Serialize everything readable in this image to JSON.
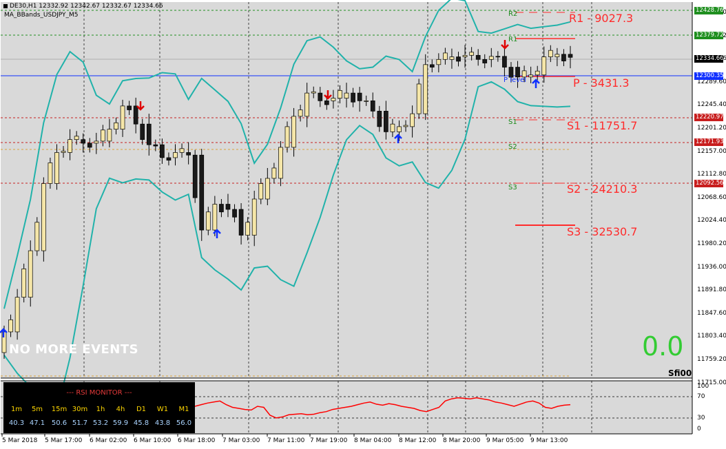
{
  "header": {
    "symbol_line": "DE30,H1  12332.92 12342.67 12332.67 12334.66",
    "indicator_line": "MA_BBands_USDJPY_M5"
  },
  "pivots": [
    {
      "tag": "R2",
      "label": ""
    },
    {
      "tag": "R1",
      "label": "R1 - 9027.3"
    },
    {
      "tag": "",
      "label": "P - 3431.3"
    },
    {
      "tag": "S1",
      "label": "S1 - 11751.7"
    },
    {
      "tag": "S2",
      "label": "S2 - 24210.3"
    },
    {
      "tag": "S3",
      "label": "S3 - 32530.7"
    }
  ],
  "plevel_label": "P level",
  "no_events_text": "NO MORE EVENTS",
  "big_value": "0.0",
  "corner_stamp": "Sfi00",
  "price_axis": [
    "12421.00",
    "12379.72",
    "12334.66",
    "12289.60",
    "12245.40",
    "12201.20",
    "12157.00",
    "12112.80",
    "12068.60",
    "12024.40",
    "11980.20",
    "11936.00",
    "11891.80",
    "11847.60",
    "11803.40",
    "11759.20",
    "11715.00"
  ],
  "price_boxes": [
    {
      "text": "12428.76",
      "color": "#1f8f1f"
    },
    {
      "text": "12379.72",
      "color": "#1f8f1f"
    },
    {
      "text": "12334.66",
      "color": "#000000"
    },
    {
      "text": "12300.35",
      "color": "#1030ff"
    },
    {
      "text": "12220.97",
      "color": "#c81e1e"
    },
    {
      "text": "12171.93",
      "color": "#c81e1e"
    },
    {
      "text": "12092.56",
      "color": "#c81e1e"
    }
  ],
  "rsi_axis": [
    "100",
    "70",
    "30",
    "0"
  ],
  "time_axis": [
    "5 Mar 2018",
    "5 Mar 17:00",
    "6 Mar 02:00",
    "6 Mar 10:00",
    "6 Mar 18:00",
    "7 Mar 03:00",
    "7 Mar 11:00",
    "7 Mar 19:00",
    "8 Mar 04:00",
    "8 Mar 12:00",
    "8 Mar 20:00",
    "9 Mar 05:00",
    "9 Mar 13:00"
  ],
  "rsi_monitor": {
    "title": "--- RSI MONITOR ---",
    "timeframes": [
      "1m",
      "5m",
      "15m",
      "30m",
      "1h",
      "4h",
      "D1",
      "W1",
      "M1"
    ],
    "values": [
      "40.3",
      "47.1",
      "50.6",
      "51.7",
      "53.2",
      "59.9",
      "45.8",
      "43.8",
      "56.0"
    ]
  },
  "colors": {
    "chart_bg": "#d9d9d9",
    "bull_candle": "#f5e6a8",
    "bear_candle": "#1a1a1a",
    "bollinger": "#20b2aa",
    "rsi_line": "#ff0000",
    "pivot_line": "#ff2b2b",
    "arrow_up": "#1030ff",
    "arrow_down": "#e00000"
  },
  "chart_data": {
    "type": "candlestick",
    "symbol": "DE30",
    "timeframe": "H1",
    "x": [
      "5 Mar 2018",
      "5 Mar 17:00",
      "6 Mar 02:00",
      "6 Mar 10:00",
      "6 Mar 18:00",
      "7 Mar 03:00",
      "7 Mar 11:00",
      "7 Mar 19:00",
      "8 Mar 04:00",
      "8 Mar 12:00",
      "8 Mar 20:00",
      "9 Mar 05:00",
      "9 Mar 13:00"
    ],
    "close_path": [
      11803,
      11870,
      11960,
      12090,
      12150,
      12175,
      12168,
      12172,
      12195,
      12240,
      12205,
      12165,
      12140,
      12150,
      12145,
      12000,
      12050,
      12040,
      11990,
      12060,
      12100,
      12160,
      12220,
      12265,
      12250,
      12255,
      12265,
      12250,
      12230,
      12190,
      12200,
      12225,
      12320,
      12330,
      12335,
      12338,
      12330,
      12336,
      12315,
      12296,
      12300,
      12335,
      12340,
      12334
    ],
    "ylim": [
      11715,
      12440
    ],
    "rsi_ylim": [
      0,
      100
    ],
    "rsi_levels": [
      30,
      70
    ]
  }
}
